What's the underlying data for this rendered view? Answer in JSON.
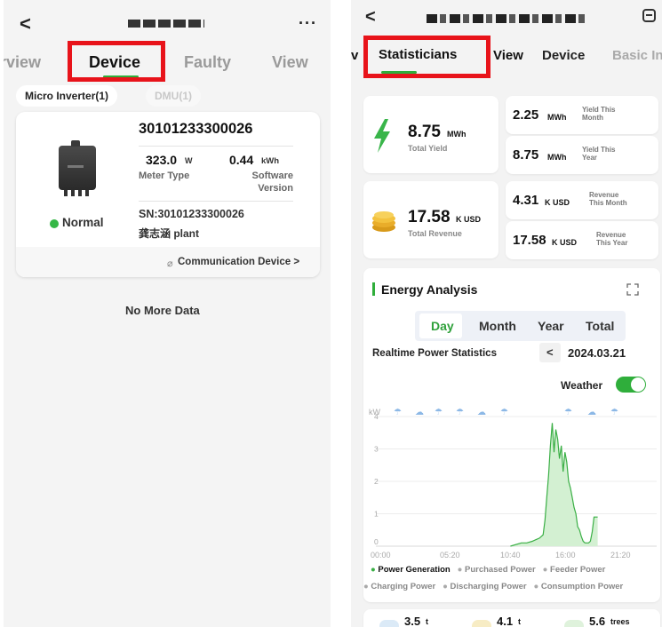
{
  "left": {
    "tabs": [
      {
        "label": "rview",
        "active": false
      },
      {
        "label": "Device",
        "active": true
      },
      {
        "label": "Faulty",
        "active": false
      },
      {
        "label": "View",
        "active": false
      }
    ],
    "chips": [
      "Micro Inverter(1)",
      "DMU(1)"
    ],
    "device": {
      "serial": "30101233300026",
      "power_value": "323.0",
      "power_unit": "W",
      "power_label": "Meter Type",
      "energy_value": "0.44",
      "energy_unit": "kWh",
      "energy_label_1": "Software",
      "energy_label_2": "Version",
      "status": "Normal",
      "sn": "SN:30101233300026",
      "plant": "龚志涵 plant",
      "comm_link": "Communication Device >"
    },
    "no_more": "No More Data",
    "colors": {
      "accent": "#2fae3b",
      "highlight": "#e8131a"
    },
    "icons": [
      "back-chevron-icon",
      "more-icon",
      "link-icon",
      "inverter-device-image"
    ]
  },
  "right": {
    "tabs": [
      {
        "label": "v",
        "active": false
      },
      {
        "label": "Statisticians",
        "active": true
      },
      {
        "label": "View",
        "active": false
      },
      {
        "label": "Device",
        "active": false
      },
      {
        "label": "Basic In",
        "active": false
      }
    ],
    "stats": {
      "total_yield_value": "8.75",
      "total_yield_unit": "MWh",
      "total_yield_label": "Total Yield",
      "yield_month_value": "2.25",
      "yield_month_unit": "MWh",
      "yield_month_label_1": "Yield This",
      "yield_month_label_2": "Month",
      "yield_year_value": "8.75",
      "yield_year_unit": "MWh",
      "yield_year_label_1": "Yield This",
      "yield_year_label_2": "Year",
      "total_revenue_value": "17.58",
      "total_revenue_unit": "K USD",
      "total_revenue_label": "Total Revenue",
      "revenue_month_value": "4.31",
      "revenue_month_unit": "K USD",
      "revenue_month_label_1": "Revenue",
      "revenue_month_label_2": "This Month",
      "revenue_year_value": "17.58",
      "revenue_year_unit": "K USD",
      "revenue_year_label_1": "Revenue",
      "revenue_year_label_2": "This Year"
    },
    "energy": {
      "title": "Energy Analysis",
      "segments": [
        {
          "label": "Day",
          "active": true
        },
        {
          "label": "Month",
          "active": false
        },
        {
          "label": "Year",
          "active": false
        },
        {
          "label": "Total",
          "active": false
        }
      ],
      "realtime_label": "Realtime Power Statistics",
      "date": "2024.03.21",
      "prev_arrow": "<",
      "weather_label": "Weather",
      "weather_on": true
    },
    "legend": [
      {
        "label": "Power Generation",
        "active": true
      },
      {
        "label": "Purchased Power",
        "active": false
      },
      {
        "label": "Feeder Power",
        "active": false
      },
      {
        "label": "Charging Power",
        "active": false
      },
      {
        "label": "Discharging Power",
        "active": false
      },
      {
        "label": "Consumption Power",
        "active": false
      }
    ],
    "bottom": [
      {
        "value": "3.5",
        "unit": "t"
      },
      {
        "value": "4.1",
        "unit": "t"
      },
      {
        "value": "5.6",
        "unit": "trees"
      }
    ],
    "colors": {
      "accent": "#2fae3b",
      "highlight": "#e8131a",
      "area_fill": "#d3f0d2",
      "line": "#3aaf45"
    },
    "icons": [
      "back-chevron-icon",
      "expand-icon",
      "lightning-icon",
      "coins-icon",
      "fullscreen-icon",
      "weather-icon"
    ]
  },
  "chart_data": {
    "type": "area",
    "ylabel": "kW",
    "ylim": [
      0,
      4
    ],
    "y_ticks": [
      "0",
      "1",
      "2",
      "3",
      "4"
    ],
    "x_ticks": [
      "00:00",
      "05:20",
      "10:40",
      "16:00",
      "21:20"
    ],
    "series": [
      {
        "name": "Power Generation",
        "x": [
          "12:00",
          "13:00",
          "13:30",
          "14:00",
          "14:20",
          "14:40",
          "15:00",
          "15:10",
          "15:20",
          "15:30",
          "15:40",
          "15:50",
          "16:00",
          "16:10",
          "16:20",
          "16:30",
          "16:40",
          "16:50",
          "17:00",
          "17:10",
          "17:20",
          "17:30",
          "17:40",
          "17:50",
          "18:00",
          "18:10",
          "18:20",
          "18:30",
          "18:40",
          "18:50",
          "19:00",
          "19:10",
          "19:20",
          "19:30",
          "19:40",
          "19:50",
          "20:00"
        ],
        "values": [
          0,
          0.1,
          0.1,
          0.15,
          0.2,
          0.25,
          0.35,
          0.8,
          1.5,
          2.2,
          3.1,
          3.8,
          2.9,
          3.6,
          3.3,
          2.7,
          3.1,
          2.3,
          2.9,
          2.6,
          2.0,
          1.8,
          1.5,
          1.2,
          1.0,
          0.6,
          0.5,
          0.3,
          0.15,
          0.1,
          0.1,
          0.1,
          0.15,
          0.45,
          0.9,
          0.9,
          0.9
        ]
      }
    ],
    "grid": true
  }
}
